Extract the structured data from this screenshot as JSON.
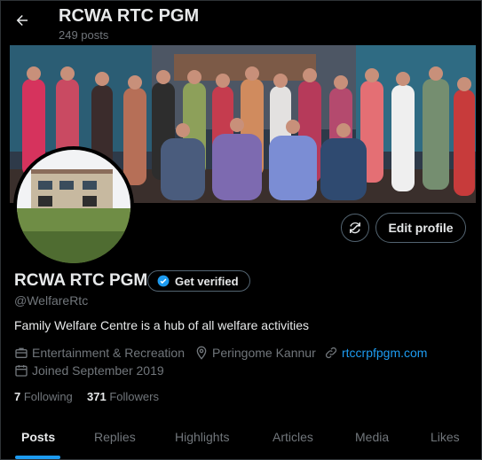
{
  "header": {
    "title": "RCWA RTC PGM",
    "post_count": "249 posts"
  },
  "profile": {
    "name": "RCWA RTC PGM",
    "verify_label": "Get verified",
    "handle": "@WelfareRtc",
    "bio": "Family Welfare Centre is a hub of all welfare activities",
    "edit_label": "Edit profile",
    "meta": {
      "category": "Entertainment & Recreation",
      "location": "Peringome Kannur",
      "website": "rtccrpfpgm.com",
      "joined": "Joined September 2019"
    },
    "following_count": "7",
    "following_label": "Following",
    "followers_count": "371",
    "followers_label": "Followers"
  },
  "tabs": [
    {
      "label": "Posts",
      "active": true
    },
    {
      "label": "Replies"
    },
    {
      "label": "Highlights"
    },
    {
      "label": "Articles"
    },
    {
      "label": "Media"
    },
    {
      "label": "Likes"
    }
  ],
  "colors": {
    "accent": "#1d9bf0",
    "background": "#000000",
    "muted": "#71767b",
    "text": "#e7e9ea"
  },
  "icons": [
    "back-arrow-icon",
    "refresh-icon",
    "verified-badge-icon",
    "briefcase-icon",
    "location-pin-icon",
    "link-icon",
    "calendar-icon"
  ]
}
